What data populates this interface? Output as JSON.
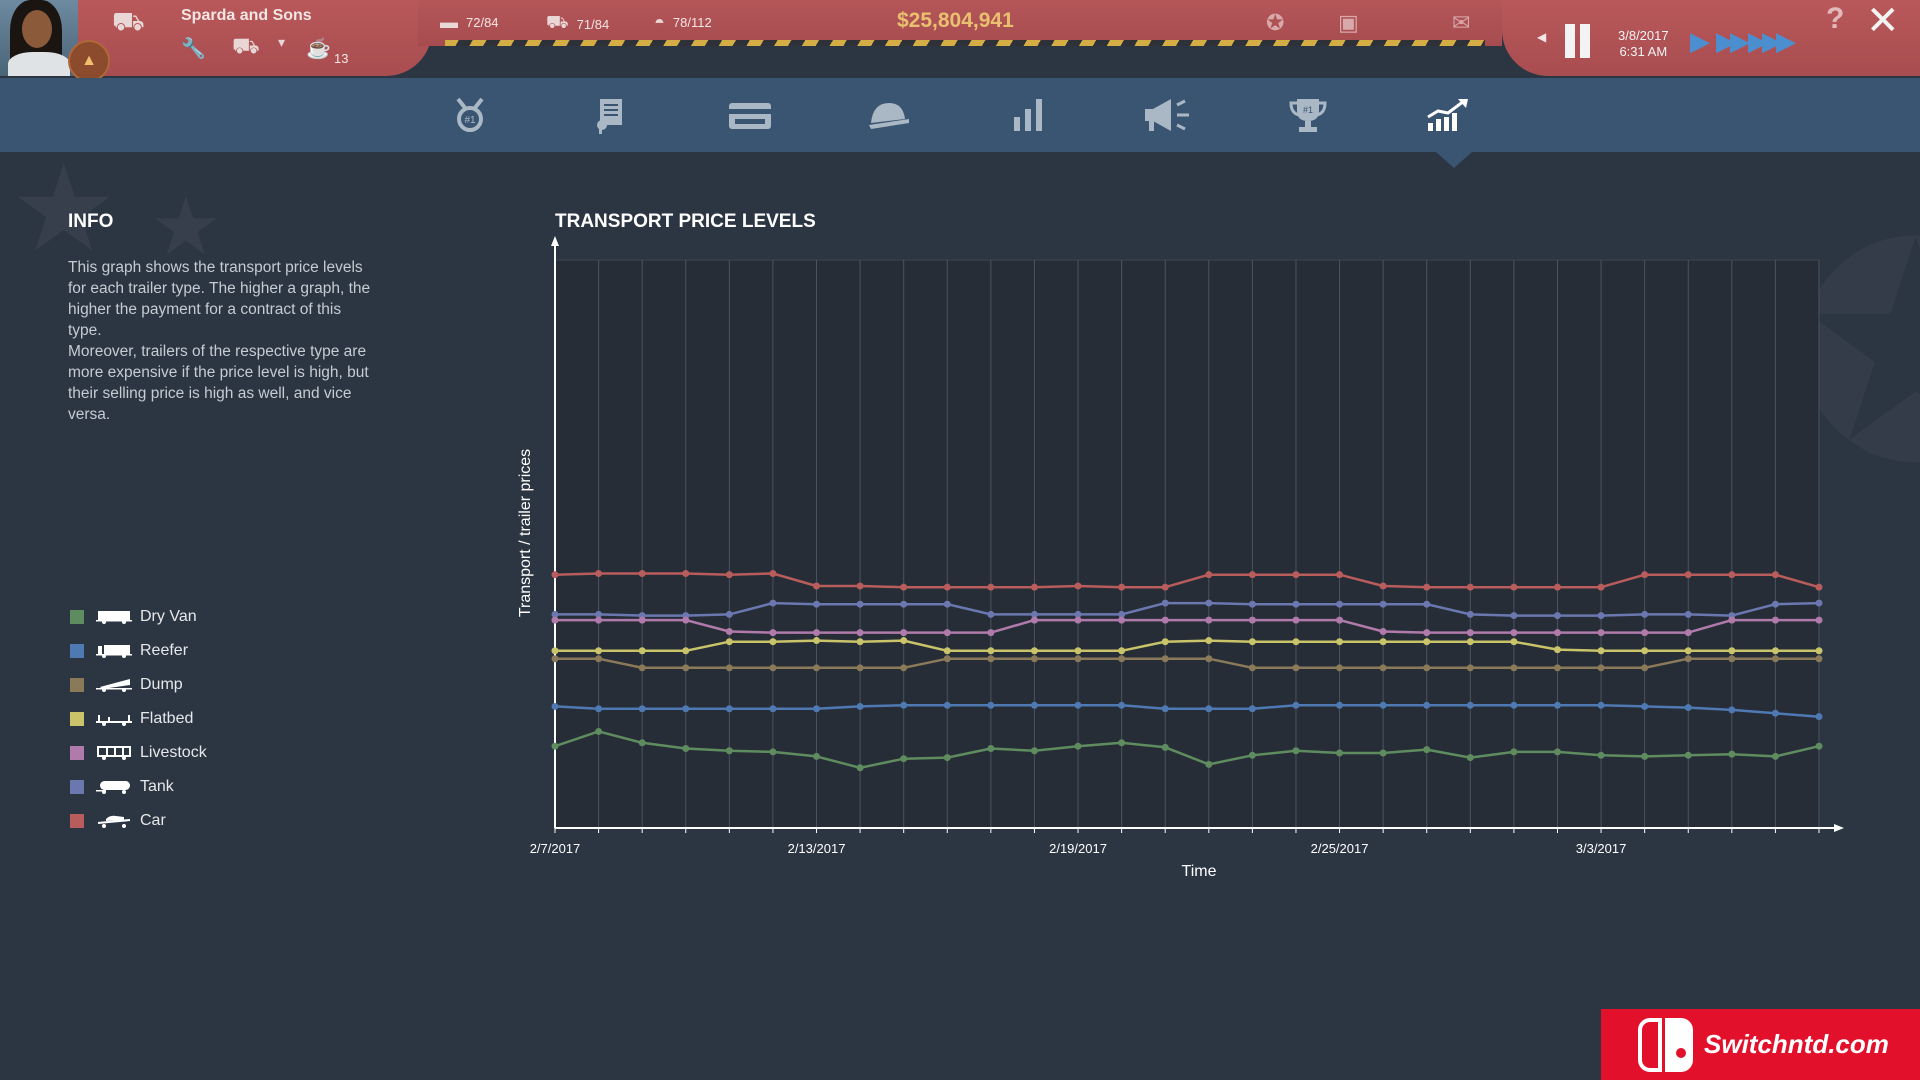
{
  "header": {
    "company_name": "Sparda and Sons",
    "coffee_count": "13",
    "stats": [
      {
        "icon": "trailer-icon",
        "value": "72/84"
      },
      {
        "icon": "truck-icon",
        "value": "71/84"
      },
      {
        "icon": "driver-cap-icon",
        "value": "78/112"
      }
    ],
    "money": "$25,804,941",
    "date": "3/8/2017",
    "time": "6:31 AM"
  },
  "tabs": [
    {
      "name": "tab-ranking",
      "icon": "medal-icon"
    },
    {
      "name": "tab-contracts",
      "icon": "certificate-icon"
    },
    {
      "name": "tab-finances",
      "icon": "credit-card-icon"
    },
    {
      "name": "tab-personnel",
      "icon": "cap-icon"
    },
    {
      "name": "tab-statistics",
      "icon": "bar-chart-icon"
    },
    {
      "name": "tab-marketing",
      "icon": "megaphone-icon"
    },
    {
      "name": "tab-awards",
      "icon": "trophy-icon"
    },
    {
      "name": "tab-price-levels",
      "icon": "trend-chart-icon",
      "active": true
    }
  ],
  "info": {
    "title": "INFO",
    "text_lines": [
      "This graph shows the transport price levels",
      "for each trailer type. The higher a graph, the",
      "higher the payment for a contract of this",
      "type.",
      "Moreover, trailers of the respective type are",
      "more expensive if the price level is high, but",
      "their selling price is high as well, and vice",
      "versa."
    ]
  },
  "legend": [
    {
      "label": "Dry Van",
      "color": "#5f8c5f",
      "icon": "dry-van-trailer-icon"
    },
    {
      "label": "Reefer",
      "color": "#4f79b2",
      "icon": "reefer-trailer-icon"
    },
    {
      "label": "Dump",
      "color": "#8a7a5a",
      "icon": "dump-trailer-icon"
    },
    {
      "label": "Flatbed",
      "color": "#c9c46a",
      "icon": "flatbed-trailer-icon"
    },
    {
      "label": "Livestock",
      "color": "#b07aaa",
      "icon": "livestock-trailer-icon"
    },
    {
      "label": "Tank",
      "color": "#6b78b0",
      "icon": "tank-trailer-icon"
    },
    {
      "label": "Car",
      "color": "#b85c5c",
      "icon": "car-transporter-icon"
    }
  ],
  "chart_data": {
    "type": "line",
    "title": "TRANSPORT PRICE LEVELS",
    "xlabel": "Time",
    "ylabel": "Transport / trailer prices",
    "x_tick_labels": [
      "2/7/2017",
      "2/13/2017",
      "2/19/2017",
      "2/25/2017",
      "3/3/2017"
    ],
    "x_tick_indices": [
      0,
      6,
      12,
      18,
      24
    ],
    "x_count": 30,
    "ylim": [
      0,
      100
    ],
    "grid": "vertical",
    "series": [
      {
        "name": "Car",
        "color": "#b85c5c",
        "values": [
          44.6,
          44.8,
          44.8,
          44.8,
          44.6,
          44.8,
          42.6,
          42.6,
          42.4,
          42.4,
          42.4,
          42.4,
          42.6,
          42.4,
          42.4,
          44.6,
          44.6,
          44.6,
          44.6,
          42.6,
          42.4,
          42.4,
          42.4,
          42.4,
          42.4,
          44.6,
          44.6,
          44.6,
          44.6,
          42.4
        ]
      },
      {
        "name": "Tank",
        "color": "#6b78b0",
        "values": [
          37.6,
          37.6,
          37.4,
          37.4,
          37.6,
          39.6,
          39.4,
          39.4,
          39.4,
          39.4,
          37.6,
          37.6,
          37.6,
          37.6,
          39.6,
          39.6,
          39.4,
          39.4,
          39.4,
          39.4,
          39.4,
          37.6,
          37.4,
          37.4,
          37.4,
          37.6,
          37.6,
          37.4,
          39.4,
          39.6
        ]
      },
      {
        "name": "Livestock",
        "color": "#b07aaa",
        "values": [
          36.6,
          36.6,
          36.6,
          36.6,
          34.6,
          34.4,
          34.4,
          34.4,
          34.4,
          34.4,
          34.4,
          36.6,
          36.6,
          36.6,
          36.6,
          36.6,
          36.6,
          36.6,
          36.6,
          34.6,
          34.4,
          34.4,
          34.4,
          34.4,
          34.4,
          34.4,
          34.4,
          36.6,
          36.6,
          36.6
        ]
      },
      {
        "name": "Flatbed",
        "color": "#c9c46a",
        "values": [
          31.2,
          31.2,
          31.2,
          31.2,
          32.8,
          32.8,
          33.0,
          32.8,
          33.0,
          31.2,
          31.2,
          31.2,
          31.2,
          31.2,
          32.8,
          33.0,
          32.8,
          32.8,
          32.8,
          32.8,
          32.8,
          32.8,
          32.8,
          31.4,
          31.2,
          31.2,
          31.2,
          31.2,
          31.2,
          31.2
        ]
      },
      {
        "name": "Dump",
        "color": "#8a7a5a",
        "values": [
          29.8,
          29.8,
          28.2,
          28.2,
          28.2,
          28.2,
          28.2,
          28.2,
          28.2,
          29.8,
          29.8,
          29.8,
          29.8,
          29.8,
          29.8,
          29.8,
          28.2,
          28.2,
          28.2,
          28.2,
          28.2,
          28.2,
          28.2,
          28.2,
          28.2,
          28.2,
          29.8,
          29.8,
          29.8,
          29.8
        ]
      },
      {
        "name": "Reefer",
        "color": "#4f79b2",
        "values": [
          21.4,
          21.0,
          21.0,
          21.0,
          21.0,
          21.0,
          21.0,
          21.4,
          21.6,
          21.6,
          21.6,
          21.6,
          21.6,
          21.6,
          21.0,
          21.0,
          21.0,
          21.6,
          21.6,
          21.6,
          21.6,
          21.6,
          21.6,
          21.6,
          21.6,
          21.4,
          21.2,
          20.8,
          20.2,
          19.6
        ]
      },
      {
        "name": "Dry Van",
        "color": "#5f8c5f",
        "values": [
          14.4,
          17.0,
          15.0,
          14.0,
          13.6,
          13.4,
          12.6,
          10.6,
          12.2,
          12.4,
          14.0,
          13.6,
          14.4,
          15.0,
          14.2,
          11.2,
          12.8,
          13.6,
          13.2,
          13.2,
          13.8,
          12.4,
          13.4,
          13.4,
          12.8,
          12.6,
          12.8,
          13.0,
          12.6,
          14.4
        ]
      }
    ]
  },
  "watermark": {
    "text": "Switchntd.com"
  }
}
